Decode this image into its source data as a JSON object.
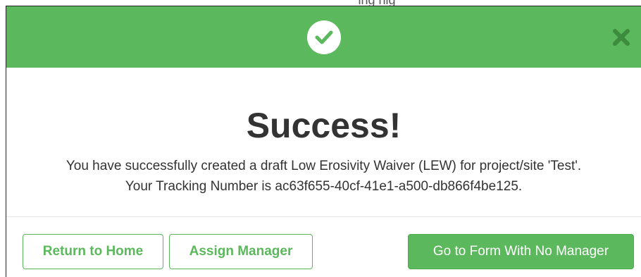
{
  "page_peek": {
    "text": "ing hig"
  },
  "modal": {
    "header": {
      "status_icon": "check-circle-icon",
      "close_icon": "close-icon",
      "color": "#5cb85c"
    },
    "title": "Success!",
    "message_line1": "You have successfully created a draft Low Erosivity Waiver (LEW) for project/site 'Test'.",
    "message_line2": "Your Tracking Number is ac63f655-40cf-41e1-a500-db866f4be125.",
    "buttons": {
      "return_home": "Return to Home",
      "assign_manager": "Assign Manager",
      "go_to_form": "Go to Form With No Manager"
    }
  }
}
